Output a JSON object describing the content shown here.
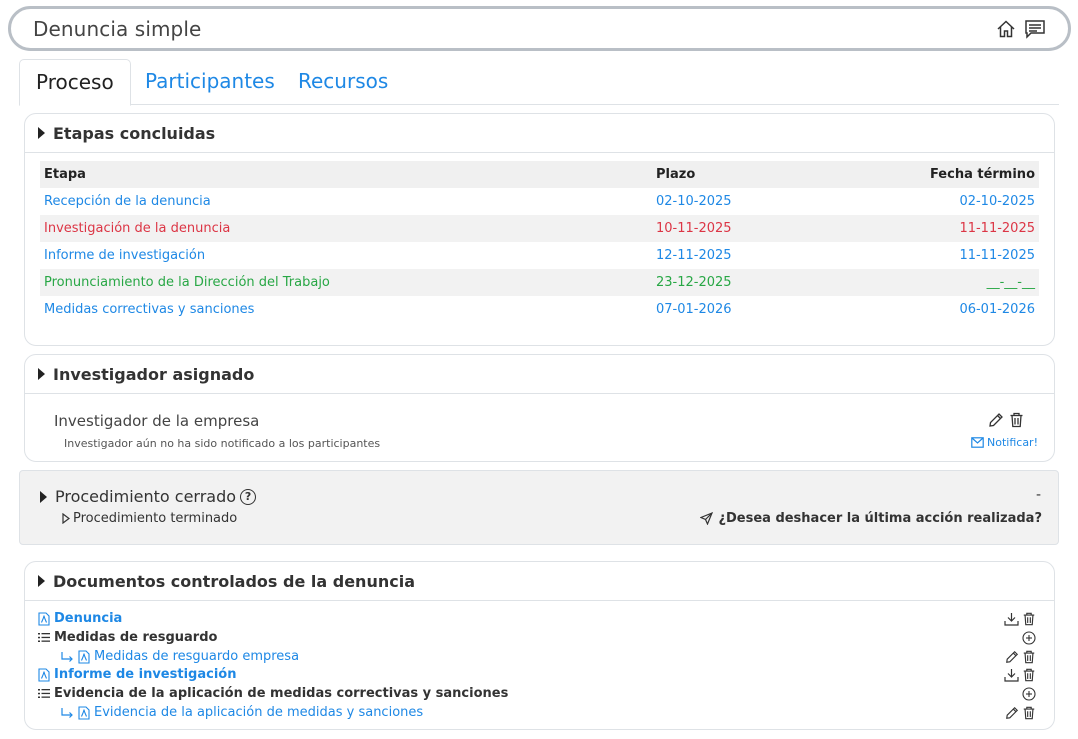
{
  "header": {
    "title": "Denuncia simple",
    "icons": [
      "home-icon",
      "chat-icon"
    ]
  },
  "tabs": [
    {
      "label": "Proceso",
      "active": true
    },
    {
      "label": "Participantes",
      "active": false
    },
    {
      "label": "Recursos",
      "active": false
    }
  ],
  "stages": {
    "title": "Etapas concluidas",
    "columns": {
      "stage": "Etapa",
      "deadline": "Plazo",
      "end_date": "Fecha término"
    },
    "rows": [
      {
        "stage": "Recepción de la denuncia",
        "deadline": "02-10-2025",
        "end_date": "02-10-2025",
        "color": "#1e88e5"
      },
      {
        "stage": "Investigación de la denuncia",
        "deadline": "10-11-2025",
        "end_date": "11-11-2025",
        "color": "#dc3545"
      },
      {
        "stage": "Informe de investigación",
        "deadline": "12-11-2025",
        "end_date": "11-11-2025",
        "color": "#1e88e5"
      },
      {
        "stage": "Pronunciamiento de la Dirección del Trabajo",
        "deadline": "23-12-2025",
        "end_date": "__-__-__",
        "color": "#28a745"
      },
      {
        "stage": "Medidas correctivas y sanciones",
        "deadline": "07-01-2026",
        "end_date": "06-01-2026",
        "color": "#1e88e5"
      }
    ]
  },
  "investigator": {
    "title": "Investigador asignado",
    "name": "Investigador de la empresa",
    "note": "Investigador aún no ha sido notificado a los participantes",
    "notify_label": "Notificar!"
  },
  "closed": {
    "title": "Procedimiento cerrado",
    "subtitle": "Procedimiento terminado",
    "dash": "-",
    "undo_label": "¿Desea deshacer la última acción realizada?"
  },
  "documents": {
    "title": "Documentos controlados de la denuncia",
    "items": [
      {
        "label": "Denuncia"
      },
      {
        "label": "Medidas de resguardo"
      },
      {
        "label": "Medidas de resguardo empresa"
      },
      {
        "label": "Informe de investigación"
      },
      {
        "label": "Evidencia de la aplicación de medidas correctivas y sanciones"
      },
      {
        "label": "Evidencia de la aplicación de medidas y sanciones"
      }
    ]
  },
  "colors": {
    "accent": "#1e88e5",
    "danger": "#dc3545",
    "success": "#28a745"
  }
}
